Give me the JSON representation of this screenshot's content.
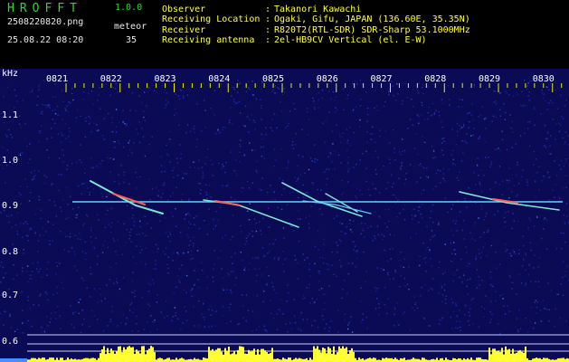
{
  "app": {
    "title": "HROFFT",
    "version": "1.0.0"
  },
  "file": {
    "name": "2508220820.png",
    "datetime": "25.08.22 08:20"
  },
  "meteor": {
    "label": "meteor",
    "count": "35"
  },
  "info": [
    {
      "key": "Observer",
      "value": "Takanori Kawachi"
    },
    {
      "key": "Receiving Location",
      "value": "Ogaki, Gifu, JAPAN (136.60E, 35.35N)"
    },
    {
      "key": "Receiver",
      "value": "R820T2(RTL-SDR) SDR-Sharp 53.1000MHz"
    },
    {
      "key": "Receiving antenna",
      "value": "2el-HB9CV Vertical (el. E-W)"
    }
  ],
  "spectrogram": {
    "unit_label": "kHz",
    "time_labels": [
      "0821",
      "0822",
      "0823",
      "0824",
      "0825",
      "0826",
      "0827",
      "0828",
      "0829",
      "0830"
    ],
    "freq_labels": [
      "1.1",
      "1.0",
      "0.9",
      "0.8",
      "0.7",
      "0.6"
    ],
    "colors": {
      "background": "#0a0a55",
      "noise": "#2a3fcc",
      "carrier": "#5fd3ff",
      "tick": "#f0f000",
      "label": "#ffffff",
      "activity": "#ffff33"
    }
  }
}
